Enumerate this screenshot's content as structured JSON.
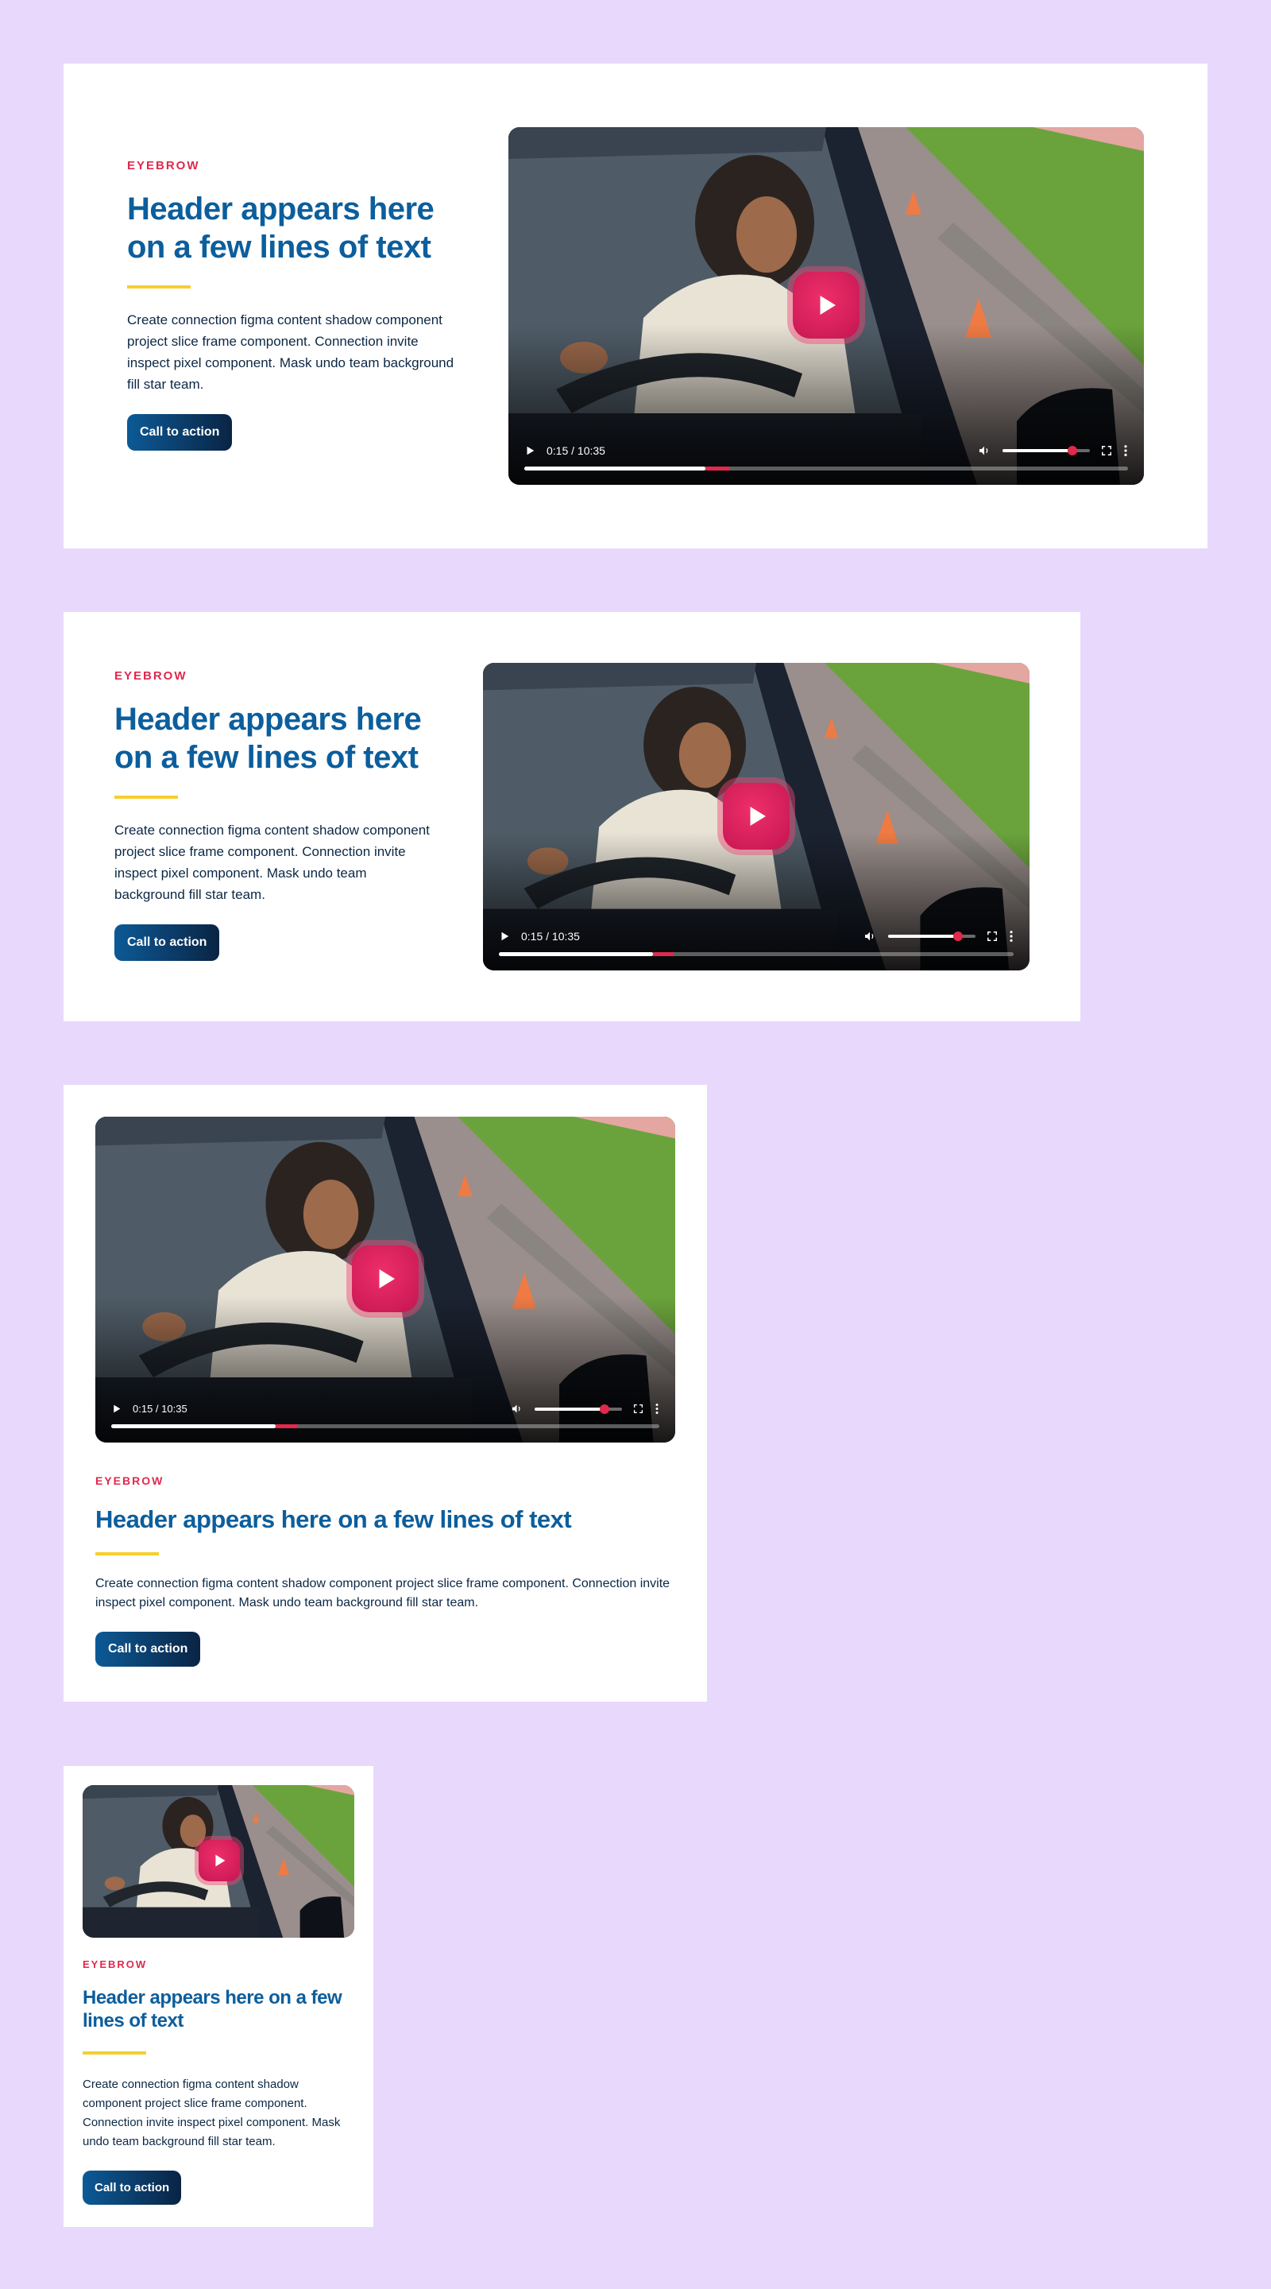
{
  "page": {
    "background": "#e8d9fc"
  },
  "colors": {
    "eyebrow": "#e0294d",
    "header": "#0c5e9c",
    "divider": "#f6cf2e",
    "cta_start": "#0c5a96",
    "cta_end": "#0a2444",
    "play_button": "#d81e5b"
  },
  "cards": [
    {
      "eyebrow": "EYEBROW",
      "header": "Header appears here on a few lines of text",
      "body": "Create connection figma content shadow component project slice frame component. Connection invite inspect pixel component. Mask undo team background fill star team.",
      "cta_label": "Call to action"
    },
    {
      "eyebrow": "EYEBROW",
      "header": "Header appears here on a few lines of text",
      "body": "Create connection figma content shadow component project slice frame component. Connection invite inspect pixel component. Mask undo team background fill star team.",
      "cta_label": "Call to action"
    },
    {
      "eyebrow": "EYEBROW",
      "header": "Header appears here on a few lines of text",
      "body": "Create connection figma content shadow component project slice frame component. Connection invite inspect pixel component. Mask undo team background fill star team.",
      "cta_label": "Call to action"
    },
    {
      "eyebrow": "EYEBROW",
      "header": "Header appears here on a few lines of text",
      "body": "Create connection figma content shadow component project slice frame component. Connection invite inspect pixel component. Mask undo team background fill star team.",
      "cta_label": "Call to action"
    }
  ],
  "video": {
    "time": "0:15 / 10:35",
    "progress": 0.3,
    "buffered": 0.34,
    "volume": 0.8,
    "icons": {
      "play": "play-icon",
      "volume": "volume-icon",
      "fullscreen": "fullscreen-icon",
      "more": "more-vertical-icon",
      "big_play": "play-button-icon"
    }
  }
}
